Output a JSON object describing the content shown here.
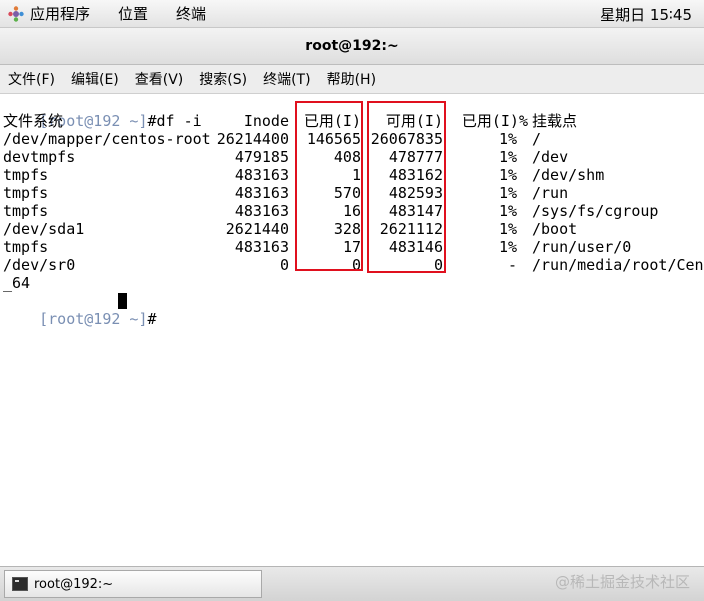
{
  "top_panel": {
    "applications": "应用程序",
    "places": "位置",
    "terminal": "终端",
    "clock": "星期日 15∶45"
  },
  "window": {
    "title": "root@192:~"
  },
  "menubar": {
    "items": [
      "文件(F)",
      "编辑(E)",
      "查看(V)",
      "搜索(S)",
      "终端(T)",
      "帮助(H)"
    ]
  },
  "terminal": {
    "prompt1": "[root@192 ~]",
    "command": "df -i",
    "headers": {
      "filesystem": "文件系统",
      "inode": "Inode",
      "used": "已用(I)",
      "avail": "可用(I)",
      "use_pct": "已用(I)%",
      "mount": "挂载点"
    },
    "rows": [
      {
        "fs": "/dev/mapper/centos-root",
        "inode": "26214400",
        "used": "146565",
        "avail": "26067835",
        "pct": "1%",
        "mount": "/"
      },
      {
        "fs": "devtmpfs",
        "inode": "479185",
        "used": "408",
        "avail": "478777",
        "pct": "1%",
        "mount": "/dev"
      },
      {
        "fs": "tmpfs",
        "inode": "483163",
        "used": "1",
        "avail": "483162",
        "pct": "1%",
        "mount": "/dev/shm"
      },
      {
        "fs": "tmpfs",
        "inode": "483163",
        "used": "570",
        "avail": "482593",
        "pct": "1%",
        "mount": "/run"
      },
      {
        "fs": "tmpfs",
        "inode": "483163",
        "used": "16",
        "avail": "483147",
        "pct": "1%",
        "mount": "/sys/fs/cgroup"
      },
      {
        "fs": "/dev/sda1",
        "inode": "2621440",
        "used": "328",
        "avail": "2621112",
        "pct": "1%",
        "mount": "/boot"
      },
      {
        "fs": "tmpfs",
        "inode": "483163",
        "used": "17",
        "avail": "483146",
        "pct": "1%",
        "mount": "/run/user/0"
      },
      {
        "fs": "/dev/sr0",
        "inode": "0",
        "used": "0",
        "avail": "0",
        "pct": "-",
        "mount": "/run/media/root/Cen"
      }
    ],
    "wrap_line": "_64",
    "prompt2": "[root@192 ~]",
    "prompt_symbol": "#"
  },
  "taskbar": {
    "task_label": "root@192:~",
    "watermark": "@稀土掘金技术社区"
  },
  "colors": {
    "highlight": "#e0101e",
    "prompt": "#7a8fb3"
  }
}
